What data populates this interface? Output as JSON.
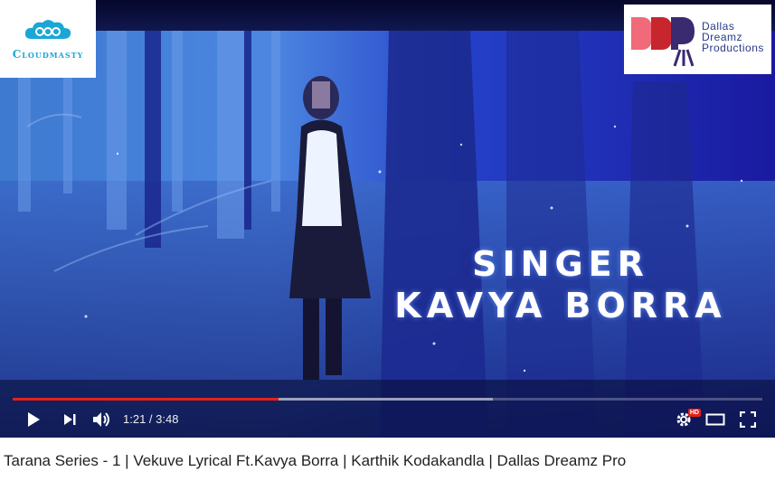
{
  "video": {
    "overlay_line1": "SINGER",
    "overlay_line2": "KAVYA BORRA",
    "logo_left_text": "Cloudmasty",
    "logo_right_text_1": "Dallas",
    "logo_right_text_2": "Dreamz",
    "logo_right_text_3": "Productions"
  },
  "player": {
    "time_display": "1:21 / 3:48",
    "progress_fraction": 0.355,
    "buffer_fraction": 0.64,
    "accent_color": "#e62117",
    "hd_badge": "HD",
    "icons": [
      "play-icon",
      "next-icon",
      "volume-icon",
      "settings-icon",
      "theater-mode-icon",
      "fullscreen-icon"
    ]
  },
  "page": {
    "title": "Tarana Series - 1 | Vekuve Lyrical Ft.Kavya Borra | Karthik Kodakandla | Dallas Dreamz Pro"
  }
}
